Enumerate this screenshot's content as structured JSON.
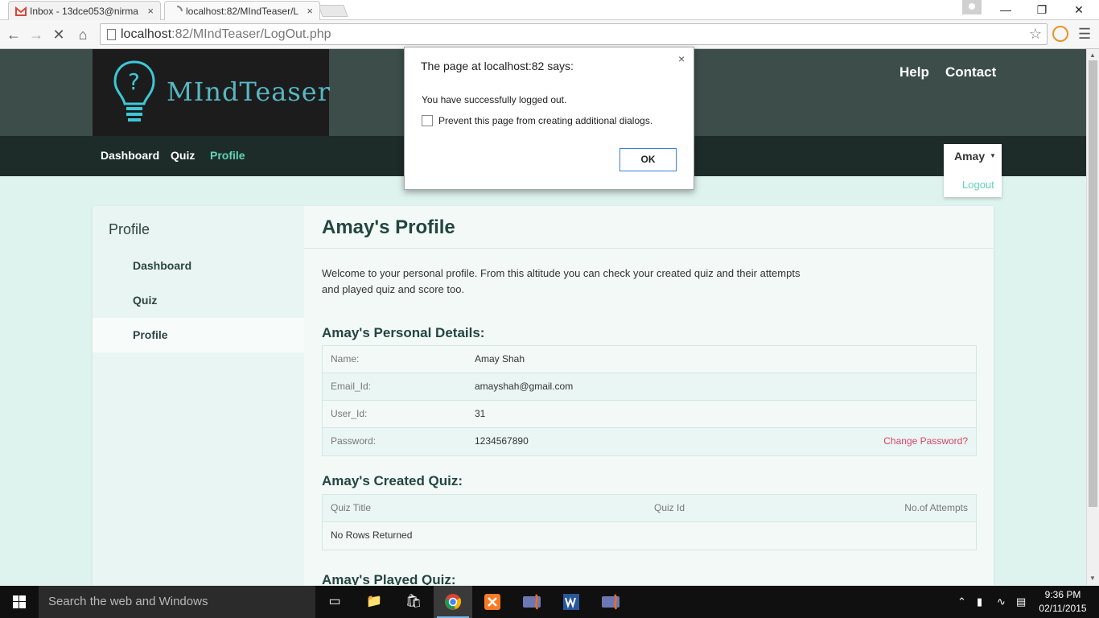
{
  "browser": {
    "tabs": [
      {
        "title": "Inbox - 13dce053@nirma",
        "close": "×"
      },
      {
        "title": "localhost:82/MIndTeaser/L",
        "close": "×"
      }
    ],
    "url_host": "localhost",
    "url_path": ":82/MIndTeaser/LogOut.php"
  },
  "site": {
    "logo_text": "MIndTeaser",
    "top_links": [
      "Help",
      "Contact"
    ],
    "nav": [
      "Dashboard",
      "Quiz",
      "Profile"
    ],
    "user": {
      "name": "Amay",
      "logout": "Logout"
    }
  },
  "sidebar": {
    "title": "Profile",
    "items": [
      "Dashboard",
      "Quiz",
      "Profile"
    ]
  },
  "main": {
    "title": "Amay's Profile",
    "intro": "Welcome to your personal profile. From this altitude you can check your created quiz and their attempts and played quiz and score too.",
    "personal_title": "Amay's Personal Details:",
    "details": [
      {
        "label": "Name:",
        "value": "Amay Shah"
      },
      {
        "label": "Email_Id:",
        "value": "amayshah@gmail.com"
      },
      {
        "label": "User_Id:",
        "value": "31"
      },
      {
        "label": "Password:",
        "value": "1234567890",
        "action": "Change Password?"
      }
    ],
    "created_title": "Amay's Created Quiz:",
    "quiz_headers": [
      "Quiz Title",
      "Quiz Id",
      "No.of Attempts"
    ],
    "no_rows": "No Rows Returned",
    "played_title": "Amay's Played Quiz:"
  },
  "dialog": {
    "title": "The page at localhost:82 says:",
    "close": "×",
    "message": "You have successfully logged out.",
    "checkbox_label": "Prevent this page from creating additional dialogs.",
    "ok": "OK"
  },
  "taskbar": {
    "search_placeholder": "Search the web and Windows",
    "time": "9:36 PM",
    "date": "02/11/2015"
  },
  "colors": {
    "accent": "#5fd3b5",
    "header_top": "#3d4e4a",
    "header_nav": "#1e2c29",
    "page_bg": "#dff3ee",
    "link_pink": "#d9436d"
  }
}
